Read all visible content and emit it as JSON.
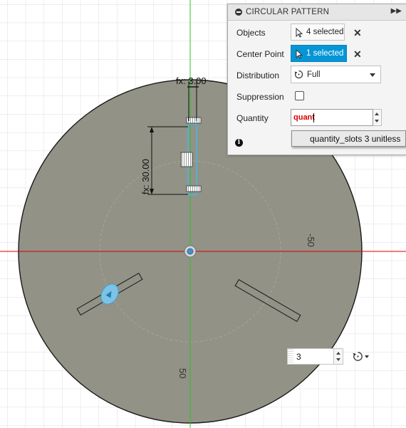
{
  "panel": {
    "title": "CIRCULAR PATTERN",
    "collapse_icon": "minus-circle-icon",
    "expand_icon": "double-chevron-right-icon",
    "rows": {
      "objects": {
        "label": "Objects",
        "value": "4 selected",
        "icon": "cursor-select-icon"
      },
      "center_point": {
        "label": "Center Point",
        "value": "1 selected",
        "icon": "cursor-select-icon",
        "active": true
      },
      "distribution": {
        "label": "Distribution",
        "value": "Full",
        "icon": "rotate-icon"
      },
      "suppression": {
        "label": "Suppression",
        "checked": false
      },
      "quantity": {
        "label": "Quantity",
        "value": "quant"
      }
    },
    "info_icon": "i"
  },
  "autocomplete": {
    "text": "quantity_slots 3 unitless"
  },
  "sketch": {
    "dim_width": "fx: 3.00",
    "dim_height": "fx: 30.00",
    "dim_radius_right": "-50",
    "dim_radius_bottom": "50"
  },
  "canvas_controls": {
    "quantity_value": "3",
    "flip_icon": "rotate-icon"
  },
  "colors": {
    "accent": "#0696d7",
    "body_fill": "#8a8a7c",
    "axis_red": "#d80000",
    "axis_green": "#27c427",
    "grid": "#d8d8d8",
    "selection_blue": "#49b6e6"
  }
}
